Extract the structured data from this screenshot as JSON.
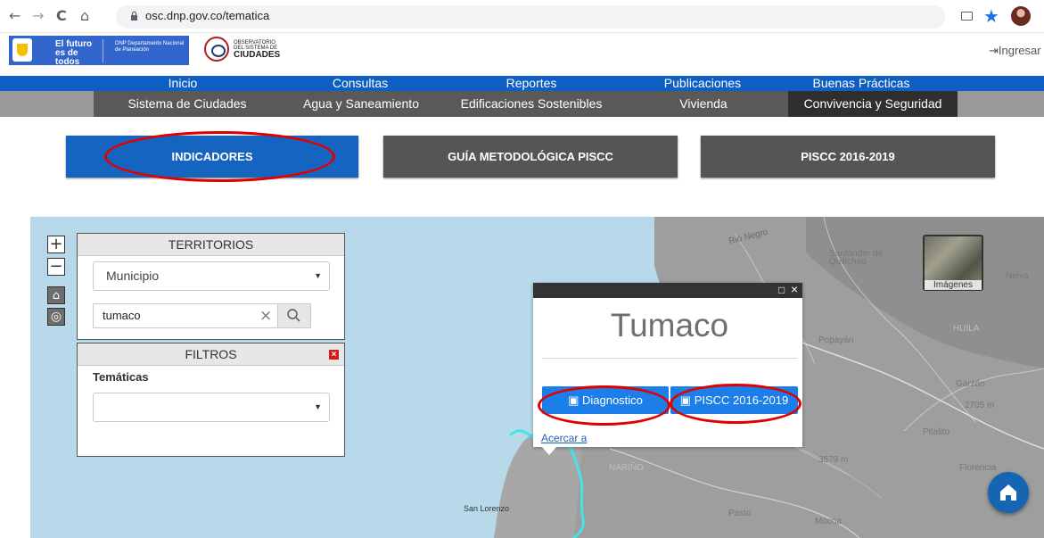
{
  "browser": {
    "url": "osc.dnp.gov.co/tematica",
    "back_icon": "←",
    "forward_icon": "→",
    "reload_icon": "C",
    "home_icon": "⌂",
    "star_icon": "★"
  },
  "header": {
    "gov_future": "El futuro es de todos",
    "gov_dnp": "DNP Departamento Nacional de Planeación",
    "observatory_small": "OBSERVATORIO DEL SISTEMA DE",
    "observatory_title": "CIUDADES",
    "login": "Ingresar"
  },
  "menu": {
    "items": [
      "Inicio",
      "Consultas",
      "Reportes",
      "Publicaciones",
      "Buenas Prácticas"
    ]
  },
  "submenu": {
    "items": [
      "Sistema de Ciudades",
      "Agua y Saneamiento",
      "Edificaciones Sostenibles",
      "Vivienda",
      "Convivencia y Seguridad"
    ]
  },
  "tabs": {
    "items": [
      "INDICADORES",
      "GUÍA METODOLÓGICA PISCC",
      "PISCC 2016-2019"
    ]
  },
  "map_controls": {
    "zoom_in": "+",
    "zoom_out": "−",
    "home": "⌂",
    "locate": "◎"
  },
  "territorios": {
    "title": "TERRITORIOS",
    "select_value": "Municipio",
    "search_value": "tumaco",
    "clear_icon": "×",
    "search_icon": "⌕"
  },
  "filtros": {
    "title": "FILTROS",
    "close": "×",
    "label": "Temáticas",
    "select_value": ""
  },
  "popup": {
    "title": "Tumaco",
    "buttons": [
      "Diagnostico",
      "PISCC 2016-2019"
    ],
    "link": "Acercar a",
    "maximize": "□",
    "close": "×"
  },
  "map_labels": {
    "rio_negro": "Rio Negro",
    "santander": "Santander de Quilichao",
    "neiva": "Neiva",
    "popayan": "Popayán",
    "huila": "HUILA",
    "garzon": "Garzón",
    "garzon_elev": "2705 m",
    "pitalito": "Pitalito",
    "narino": "NARIÑO",
    "elev": "3579 m",
    "florencia": "Florencia",
    "pasto": "Pasto",
    "mocoa": "Mocoa",
    "san_lorenzo": "San Lorenzo",
    "imagenes": "Imágenes"
  },
  "colors": {
    "primary_blue": "#1565c0",
    "nav_blue": "#0d5fc3",
    "highlight_red": "#e10000",
    "map_water": "#b7d8ea",
    "map_land": "#9d9d9d",
    "boundary_cyan": "#46e3e8"
  }
}
